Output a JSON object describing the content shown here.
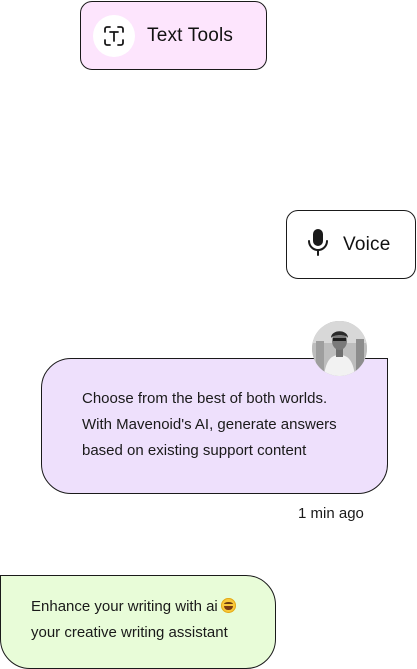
{
  "text_tools": {
    "label": "Text Tools",
    "icon": "text-scan-icon"
  },
  "voice": {
    "label": "Voice",
    "icon": "microphone-icon"
  },
  "ai_message": {
    "lines": [
      "Choose from the best of both worlds.",
      "With Mavenoid's AI, generate answers",
      "based on existing support content"
    ],
    "timestamp": "1 min ago",
    "avatar": "user-avatar"
  },
  "writing_message": {
    "lines": [
      "Enhance your writing with ai",
      "your creative writing assistant"
    ],
    "emoji": "grinning-face-emoji"
  },
  "colors": {
    "text_tools_bg": "#fde5fd",
    "ai_bubble_bg": "#eee0fc",
    "writing_bubble_bg": "#e8fcd8",
    "border": "#1a1a1a"
  }
}
